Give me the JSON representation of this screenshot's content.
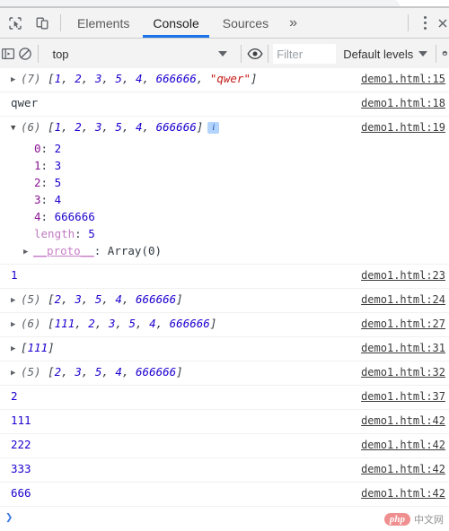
{
  "devtools": {
    "tabs": [
      {
        "label": "Elements",
        "active": false
      },
      {
        "label": "Console",
        "active": true
      },
      {
        "label": "Sources",
        "active": false
      }
    ],
    "more_tabs_label": "»",
    "inspect_icon": "inspect-element-icon",
    "device_icon": "device-toolbar-icon",
    "menu_icon": "main-menu-icon",
    "close_icon": "close-devtools-icon"
  },
  "console_toolbar": {
    "sidebar_icon": "console-sidebar-icon",
    "clear_icon": "clear-console-icon",
    "context_value": "top",
    "eye_icon": "live-expression-icon",
    "filter_placeholder": "Filter",
    "filter_value": "",
    "levels_label": "Default levels",
    "settings_icon": "console-settings-icon"
  },
  "messages": [
    {
      "type": "array",
      "expanded": false,
      "count": "(7)",
      "tokens": [
        {
          "t": "[",
          "c": "br"
        },
        {
          "t": "1",
          "c": "num"
        },
        {
          "t": ", ",
          "c": "br"
        },
        {
          "t": "2",
          "c": "num"
        },
        {
          "t": ", ",
          "c": "br"
        },
        {
          "t": "3",
          "c": "num"
        },
        {
          "t": ", ",
          "c": "br"
        },
        {
          "t": "5",
          "c": "num"
        },
        {
          "t": ", ",
          "c": "br"
        },
        {
          "t": "4",
          "c": "num"
        },
        {
          "t": ", ",
          "c": "br"
        },
        {
          "t": "666666",
          "c": "num"
        },
        {
          "t": ", ",
          "c": "br"
        },
        {
          "t": "\"qwer\"",
          "c": "str"
        },
        {
          "t": "]",
          "c": "br"
        }
      ],
      "source": "demo1.html:15"
    },
    {
      "type": "text",
      "text": "qwer",
      "source": "demo1.html:18"
    },
    {
      "type": "array",
      "expanded": true,
      "count": "(6)",
      "tokens": [
        {
          "t": "[",
          "c": "br"
        },
        {
          "t": "1",
          "c": "num"
        },
        {
          "t": ", ",
          "c": "br"
        },
        {
          "t": "2",
          "c": "num"
        },
        {
          "t": ", ",
          "c": "br"
        },
        {
          "t": "3",
          "c": "num"
        },
        {
          "t": ", ",
          "c": "br"
        },
        {
          "t": "5",
          "c": "num"
        },
        {
          "t": ", ",
          "c": "br"
        },
        {
          "t": "4",
          "c": "num"
        },
        {
          "t": ", ",
          "c": "br"
        },
        {
          "t": "666666",
          "c": "num"
        },
        {
          "t": "]",
          "c": "br"
        }
      ],
      "info_badge": "i",
      "source": "demo1.html:19",
      "properties": [
        {
          "key": "0",
          "value": "2"
        },
        {
          "key": "1",
          "value": "3"
        },
        {
          "key": "2",
          "value": "5"
        },
        {
          "key": "3",
          "value": "4"
        },
        {
          "key": "4",
          "value": "666666"
        }
      ],
      "length_key": "length",
      "length_value": "5",
      "proto_key": "__proto__",
      "proto_value": "Array(0)"
    },
    {
      "type": "number",
      "text": "1",
      "source": "demo1.html:23"
    },
    {
      "type": "array",
      "expanded": false,
      "count": "(5)",
      "tokens": [
        {
          "t": "[",
          "c": "br"
        },
        {
          "t": "2",
          "c": "num"
        },
        {
          "t": ", ",
          "c": "br"
        },
        {
          "t": "3",
          "c": "num"
        },
        {
          "t": ", ",
          "c": "br"
        },
        {
          "t": "5",
          "c": "num"
        },
        {
          "t": ", ",
          "c": "br"
        },
        {
          "t": "4",
          "c": "num"
        },
        {
          "t": ", ",
          "c": "br"
        },
        {
          "t": "666666",
          "c": "num"
        },
        {
          "t": "]",
          "c": "br"
        }
      ],
      "source": "demo1.html:24"
    },
    {
      "type": "array",
      "expanded": false,
      "count": "(6)",
      "tokens": [
        {
          "t": "[",
          "c": "br"
        },
        {
          "t": "111",
          "c": "num"
        },
        {
          "t": ", ",
          "c": "br"
        },
        {
          "t": "2",
          "c": "num"
        },
        {
          "t": ", ",
          "c": "br"
        },
        {
          "t": "3",
          "c": "num"
        },
        {
          "t": ", ",
          "c": "br"
        },
        {
          "t": "5",
          "c": "num"
        },
        {
          "t": ", ",
          "c": "br"
        },
        {
          "t": "4",
          "c": "num"
        },
        {
          "t": ", ",
          "c": "br"
        },
        {
          "t": "666666",
          "c": "num"
        },
        {
          "t": "]",
          "c": "br"
        }
      ],
      "source": "demo1.html:27"
    },
    {
      "type": "array",
      "expanded": false,
      "count": "",
      "tokens": [
        {
          "t": "[",
          "c": "br"
        },
        {
          "t": "111",
          "c": "num"
        },
        {
          "t": "]",
          "c": "br"
        }
      ],
      "source": "demo1.html:31"
    },
    {
      "type": "array",
      "expanded": false,
      "count": "(5)",
      "tokens": [
        {
          "t": "[",
          "c": "br"
        },
        {
          "t": "2",
          "c": "num"
        },
        {
          "t": ", ",
          "c": "br"
        },
        {
          "t": "3",
          "c": "num"
        },
        {
          "t": ", ",
          "c": "br"
        },
        {
          "t": "5",
          "c": "num"
        },
        {
          "t": ", ",
          "c": "br"
        },
        {
          "t": "4",
          "c": "num"
        },
        {
          "t": ", ",
          "c": "br"
        },
        {
          "t": "666666",
          "c": "num"
        },
        {
          "t": "]",
          "c": "br"
        }
      ],
      "source": "demo1.html:32"
    },
    {
      "type": "number",
      "text": "2",
      "source": "demo1.html:37"
    },
    {
      "type": "number",
      "text": "111",
      "source": "demo1.html:42"
    },
    {
      "type": "number",
      "text": "222",
      "source": "demo1.html:42"
    },
    {
      "type": "number",
      "text": "333",
      "source": "demo1.html:42"
    },
    {
      "type": "number",
      "text": "666",
      "source": "demo1.html:42"
    }
  ],
  "prompt": {
    "chevron": "❯",
    "value": ""
  },
  "watermark": {
    "badge": "php",
    "text": "中文网"
  },
  "colors": {
    "accent": "#1a73e8",
    "number": "#1c00cf",
    "string": "#c41a16",
    "property": "#881391",
    "toolbar_bg": "#f3f3f3",
    "info_badge": "#b3d4fc"
  }
}
